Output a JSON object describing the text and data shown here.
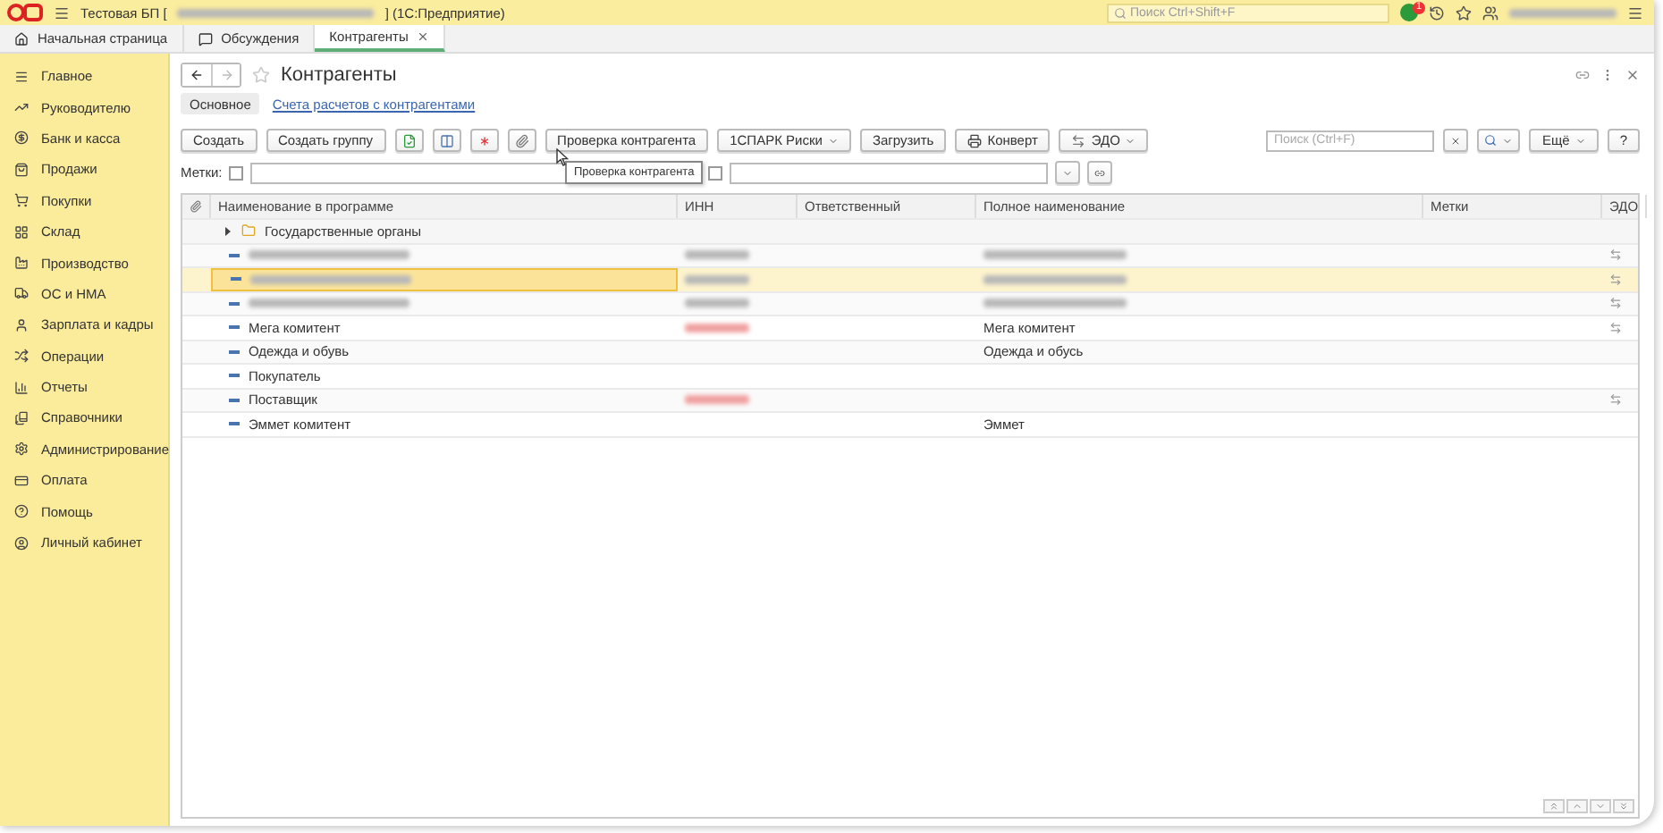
{
  "title_bar": {
    "title_start": "Тестовая БП [",
    "title_end": "] (1С:Предприятие)",
    "search_placeholder": "Поиск Ctrl+Shift+F",
    "notification_count": "1"
  },
  "tabs": [
    {
      "kind": "home",
      "label": "Начальная страница",
      "selected": false
    },
    {
      "kind": "discussions",
      "label": "Обсуждения",
      "selected": false
    },
    {
      "kind": "closable",
      "label": "Контрагенты",
      "selected": true
    }
  ],
  "sidebar": {
    "items": [
      {
        "label": "Главное"
      },
      {
        "label": "Руководителю"
      },
      {
        "label": "Банк и касса"
      },
      {
        "label": "Продажи"
      },
      {
        "label": "Покупки"
      },
      {
        "label": "Склад"
      },
      {
        "label": "Производство"
      },
      {
        "label": "ОС и НМА"
      },
      {
        "label": "Зарплата и кадры"
      },
      {
        "label": "Операции"
      },
      {
        "label": "Отчеты"
      },
      {
        "label": "Справочники"
      },
      {
        "label": "Администрирование"
      },
      {
        "label": "Оплата"
      },
      {
        "label": "Помощь"
      },
      {
        "label": "Личный кабинет"
      }
    ]
  },
  "form": {
    "title": "Контрагенты",
    "sections": [
      {
        "label": "Основное",
        "selected": true
      },
      {
        "label": "Счета расчетов с контрагентами",
        "selected": false
      }
    ],
    "toolbar": [
      {
        "kind": "button",
        "label": "Создать"
      },
      {
        "kind": "button",
        "label": "Создать группу"
      },
      {
        "kind": "icon"
      },
      {
        "kind": "icon"
      },
      {
        "kind": "icon"
      },
      {
        "kind": "icon"
      },
      {
        "kind": "button",
        "label": "Проверка контрагента"
      },
      {
        "kind": "dropdown",
        "label": "1СПАРК Риски"
      },
      {
        "kind": "button",
        "label": "Загрузить"
      },
      {
        "kind": "button",
        "label": "Конверт"
      },
      {
        "kind": "dropdown",
        "label": "ЭДО"
      }
    ],
    "tooltip": "Проверка контрагента",
    "filter": {
      "label": "Метки:",
      "checkboxes": [
        {
          "checked": false
        },
        {
          "checked": false
        }
      ]
    },
    "search": {
      "placeholder": "Поиск (Ctrl+F)"
    },
    "more_button": "Ещё",
    "help_button": "?"
  },
  "table": {
    "columns": [
      "Наименование в программе",
      "ИНН",
      "Ответственный",
      "Полное наименование",
      "Метки",
      "ЭДО"
    ],
    "rows": [
      {
        "kind": "group",
        "name": "Государственные органы",
        "expanded": false,
        "selected": false,
        "redacted": false,
        "edo": false
      },
      {
        "kind": "item",
        "redacted": true,
        "inn_error": false,
        "edo": true,
        "selected": false
      },
      {
        "kind": "item",
        "redacted": true,
        "inn_error": false,
        "edo": true,
        "selected": true
      },
      {
        "kind": "item",
        "redacted": true,
        "inn_error": false,
        "edo": true,
        "selected": false
      },
      {
        "kind": "item",
        "name": "Мега комитент",
        "full_name": "Мега комитент",
        "redacted": false,
        "inn_error": true,
        "edo": true,
        "selected": false
      },
      {
        "kind": "item",
        "name": "Одежда и обувь",
        "full_name": "Одежда и обусь",
        "redacted": false,
        "edo": false,
        "selected": false
      },
      {
        "kind": "item",
        "name": "Покупатель",
        "redacted": false,
        "edo": false,
        "selected": false
      },
      {
        "kind": "item",
        "name": "Поставщик",
        "redacted": false,
        "inn_error": true,
        "edo": true,
        "selected": false
      },
      {
        "kind": "item",
        "name": "Эммет комитент",
        "full_name": "Эммет",
        "redacted": false,
        "edo": false,
        "selected": false
      }
    ]
  }
}
